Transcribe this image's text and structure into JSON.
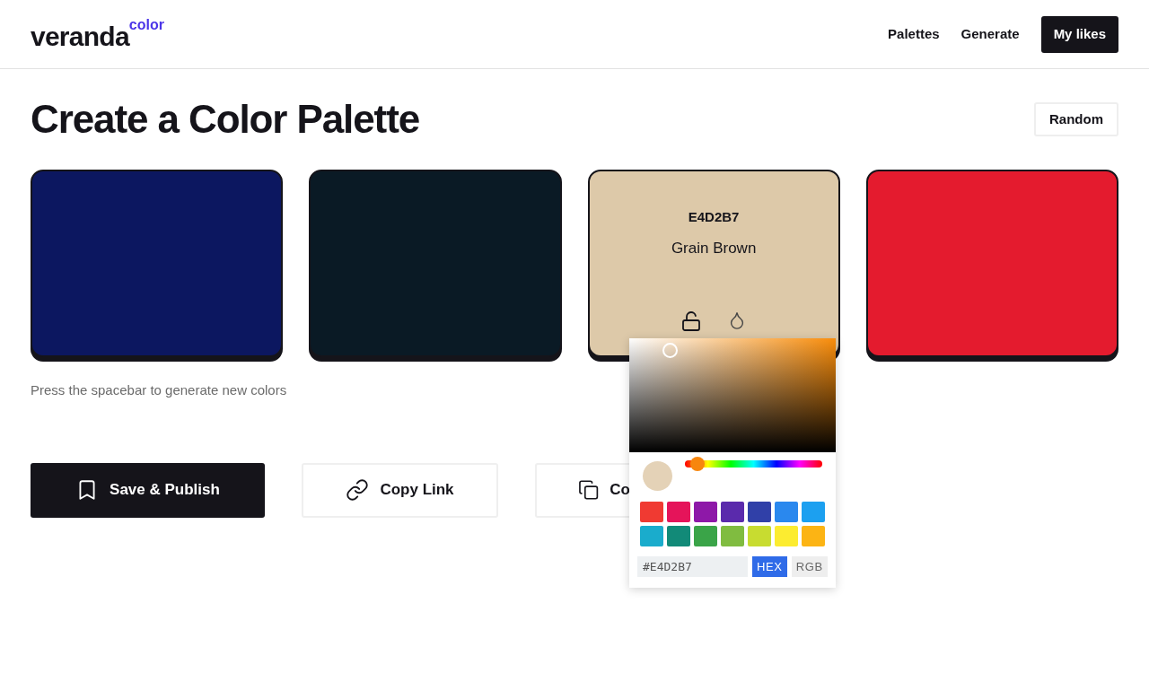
{
  "header": {
    "logo": "veranda",
    "logo_suffix": "color",
    "nav": [
      {
        "label": "Palettes",
        "kind": "link"
      },
      {
        "label": "Generate",
        "kind": "link"
      },
      {
        "label": "My likes",
        "kind": "primary"
      }
    ]
  },
  "title": "Create a Color Palette",
  "random_button": "Random",
  "swatches": [
    {
      "color": "#0c1760"
    },
    {
      "color": "#0a1a25"
    },
    {
      "color": "#ddc9a9",
      "hex": "E4D2B7",
      "name": "Grain Brown",
      "locked": false
    },
    {
      "color": "#e41b2e"
    }
  ],
  "hint": "Press the spacebar to generate new colors",
  "actions": [
    {
      "label": "Save & Publish",
      "kind": "primary"
    },
    {
      "label": "Copy Link",
      "kind": "secondary"
    },
    {
      "label": "Co",
      "kind": "secondary"
    }
  ],
  "picker": {
    "hue": {
      "level": 0.09
    },
    "presets": [
      {
        "color": "#f03a32"
      },
      {
        "color": "#e5145a"
      },
      {
        "color": "#8e18a8"
      },
      {
        "color": "#5a2aac"
      },
      {
        "color": "#3040a8"
      },
      {
        "color": "#2a88ee"
      },
      {
        "color": "#1ca0f0"
      },
      {
        "color": "#1aaccc"
      },
      {
        "color": "#128a78"
      },
      {
        "color": "#3aa448"
      },
      {
        "color": "#80bc40"
      },
      {
        "color": "#c8dc30"
      },
      {
        "color": "#fcec30"
      },
      {
        "color": "#fcb414"
      }
    ],
    "value": "#E4D2B7",
    "modes": [
      {
        "label": "HEX",
        "selected": true
      },
      {
        "label": "RGB",
        "selected": false
      }
    ]
  }
}
